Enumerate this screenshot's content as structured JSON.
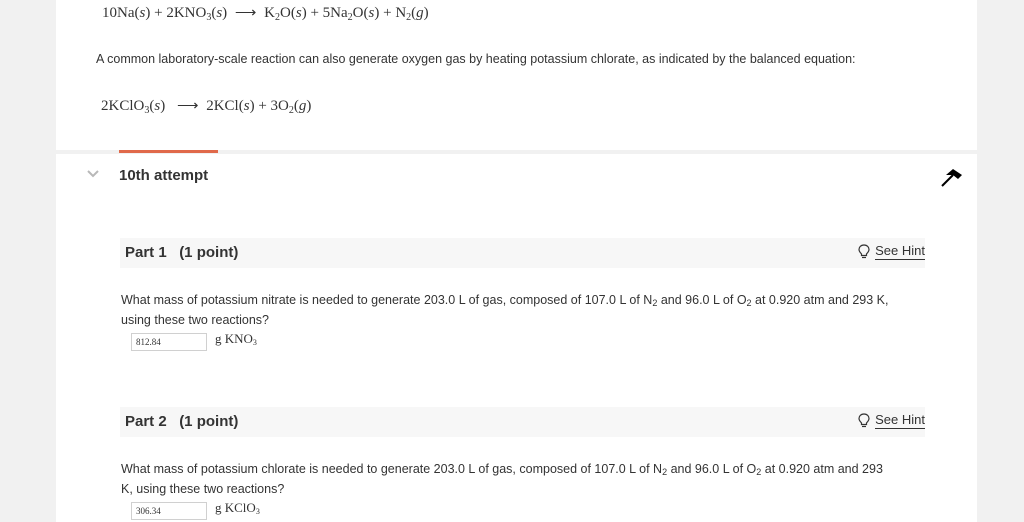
{
  "equation_1": {
    "c1": "10Na",
    "p1": "(",
    "s1": "s",
    "q1": ")",
    "plus1": " + ",
    "c2": "2KNO",
    "sub2": "3",
    "p2": "(",
    "s2": "s",
    "q2": ")",
    "arrow": "⟶",
    "c3": "K",
    "sub3": "2",
    "c3b": "O",
    "p3": "(",
    "s3": "s",
    "q3": ")",
    "plus2": " + ",
    "c4": "5Na",
    "sub4": "2",
    "c4b": "O",
    "p4": "(",
    "s4": "s",
    "q4": ")",
    "plus3": " + ",
    "c5": "N",
    "sub5": "2",
    "p5": "(",
    "s5": "g",
    "q5": ")"
  },
  "intro_text": "A common laboratory-scale reaction can also generate oxygen gas by heating potassium chlorate, as indicated by the balanced equation:",
  "equation_2": {
    "c1": "2KClO",
    "sub1": "3",
    "p1": "(",
    "s1": "s",
    "q1": ")",
    "arrow": "⟶",
    "c2": "2KCl",
    "p2": "(",
    "s2": "s",
    "q2": ")",
    "plus": " + ",
    "c3": "3O",
    "sub3": "2",
    "p3": "(",
    "s3": "g",
    "q3": ")"
  },
  "attempt_title": "10th attempt",
  "part1": {
    "title": "Part 1   (1 point)",
    "hint": "See Hint",
    "q_a": "What mass of potassium nitrate is needed to generate 203.0  L of gas, composed of 107.0  L of N",
    "q_sub1": "2",
    "q_b": " and 96.0  L of O",
    "q_sub2": "2",
    "q_c": " at 0.920 atm and 293  K, using these two reactions?",
    "answer": "812.84",
    "unit": "g KNO",
    "unit_sub": "3"
  },
  "part2": {
    "title": "Part 2   (1 point)",
    "hint": "See Hint",
    "q_a": "What mass of potassium chlorate is needed to generate 203.0 L of gas, composed of 107.0 L of N",
    "q_sub1": "2",
    "q_b": " and 96.0 L of O",
    "q_sub2": "2",
    "q_c": " at 0.920 atm and 293 K, using these two reactions?",
    "answer": "306.34",
    "unit": "g KClO",
    "unit_sub": "3"
  },
  "colors": {
    "accent": "#e0694a",
    "background": "#f1f1f1",
    "text": "#333333"
  },
  "icons": {
    "attempt_toggle": "chevron-down-icon",
    "collapse": "collapse-arrow-icon",
    "hint": "lightbulb-icon"
  }
}
